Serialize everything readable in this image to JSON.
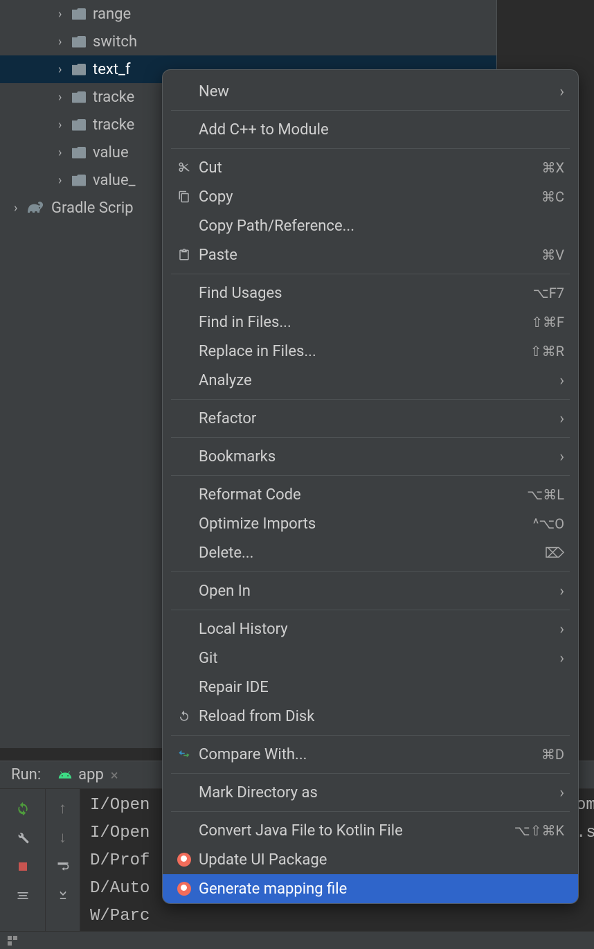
{
  "tree": {
    "items": [
      {
        "label": "range",
        "indent": 84,
        "selected": false
      },
      {
        "label": "switch",
        "indent": 84,
        "selected": false
      },
      {
        "label": "text_f",
        "indent": 84,
        "selected": true
      },
      {
        "label": "tracke",
        "indent": 84,
        "selected": false
      },
      {
        "label": "tracke",
        "indent": 84,
        "selected": false
      },
      {
        "label": "value",
        "indent": 84,
        "selected": false
      },
      {
        "label": "value_",
        "indent": 84,
        "selected": false
      }
    ],
    "gradle_label": "Gradle Scrip"
  },
  "run": {
    "label": "Run:",
    "tab_name": "app"
  },
  "console": {
    "lines": [
      "I/Open",
      "I/Open",
      "D/Prof",
      "D/Auto",
      "W/Parc"
    ],
    "right_lines": [
      "",
      "",
      "",
      "om",
      ".s"
    ]
  },
  "menu": {
    "items": [
      {
        "icon": "",
        "label": "New",
        "right": "",
        "submenu": true
      },
      {
        "sep": true
      },
      {
        "icon": "",
        "label": "Add C++ to Module",
        "right": ""
      },
      {
        "sep": true
      },
      {
        "icon": "cut",
        "label": "Cut",
        "right": "⌘X"
      },
      {
        "icon": "copy",
        "label": "Copy",
        "right": "⌘C"
      },
      {
        "icon": "",
        "label": "Copy Path/Reference...",
        "right": ""
      },
      {
        "icon": "paste",
        "label": "Paste",
        "right": "⌘V"
      },
      {
        "sep": true
      },
      {
        "icon": "",
        "label": "Find Usages",
        "right": "⌥F7"
      },
      {
        "icon": "",
        "label": "Find in Files...",
        "right": "⇧⌘F"
      },
      {
        "icon": "",
        "label": "Replace in Files...",
        "right": "⇧⌘R"
      },
      {
        "icon": "",
        "label": "Analyze",
        "right": "",
        "submenu": true
      },
      {
        "sep": true
      },
      {
        "icon": "",
        "label": "Refactor",
        "right": "",
        "submenu": true
      },
      {
        "sep": true
      },
      {
        "icon": "",
        "label": "Bookmarks",
        "right": "",
        "submenu": true
      },
      {
        "sep": true
      },
      {
        "icon": "",
        "label": "Reformat Code",
        "right": "⌥⌘L"
      },
      {
        "icon": "",
        "label": "Optimize Imports",
        "right": "^⌥O"
      },
      {
        "icon": "",
        "label": "Delete...",
        "right": "⌦"
      },
      {
        "sep": true
      },
      {
        "icon": "",
        "label": "Open In",
        "right": "",
        "submenu": true
      },
      {
        "sep": true
      },
      {
        "icon": "",
        "label": "Local History",
        "right": "",
        "submenu": true
      },
      {
        "icon": "",
        "label": "Git",
        "right": "",
        "submenu": true
      },
      {
        "icon": "",
        "label": "Repair IDE",
        "right": ""
      },
      {
        "icon": "reload",
        "label": "Reload from Disk",
        "right": ""
      },
      {
        "sep": true
      },
      {
        "icon": "compare",
        "label": "Compare With...",
        "right": "⌘D"
      },
      {
        "sep": true
      },
      {
        "icon": "",
        "label": "Mark Directory as",
        "right": "",
        "submenu": true
      },
      {
        "sep": true
      },
      {
        "icon": "",
        "label": "Convert Java File to Kotlin File",
        "right": "⌥⇧⌘K"
      },
      {
        "icon": "relay",
        "label": "Update UI Package",
        "right": ""
      },
      {
        "icon": "relay",
        "label": "Generate mapping file",
        "right": "",
        "highlight": true
      }
    ]
  }
}
